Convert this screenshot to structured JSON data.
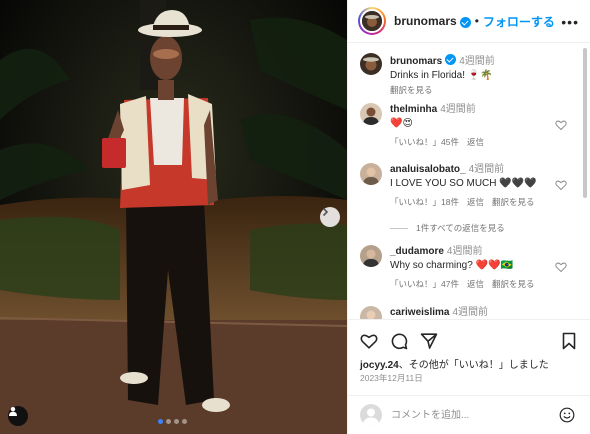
{
  "post": {
    "username": "brunomars",
    "follow_label": "フォローする",
    "dot": "•",
    "more_label": "•••"
  },
  "caption": {
    "username": "brunomars",
    "time": "4週間前",
    "text": "Drinks in Florida! 🍷🌴",
    "translate": "翻訳を見る"
  },
  "comments": [
    {
      "username": "thelminha",
      "time": "4週間前",
      "text": "❤️😍",
      "like_label": "「いいね！」45件",
      "reply": "返信"
    },
    {
      "username": "analuisalobato_",
      "time": "4週間前",
      "text": "I LOVE YOU SO MUCH 🖤🖤🖤",
      "like_label": "「いいね！」18件",
      "reply": "返信",
      "translate": "翻訳を見る"
    },
    {
      "username": "_dudamore",
      "time": "4週間前",
      "text": "Why so charming? ❤️❤️🇧🇷",
      "like_label": "「いいね！」47件",
      "reply": "返信",
      "translate": "翻訳を見る"
    },
    {
      "username": "cariweislima",
      "time": "4週間前"
    }
  ],
  "more_replies": "1件すべての返信を見る",
  "likes": {
    "user": "jocyy.24",
    "suffix": "、その他が「いいね！」しました"
  },
  "date": "2023年12月11日",
  "comment_input": {
    "placeholder": "コメントを追加..."
  },
  "carousel": {
    "count": 4,
    "active": 0
  },
  "colors": {
    "accent": "#0095f6",
    "carousel_active": "#3b82f6"
  }
}
